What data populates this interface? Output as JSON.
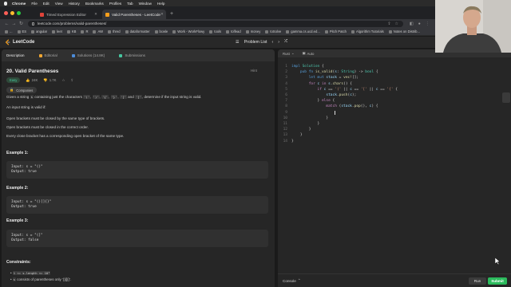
{
  "menubar": {
    "app": "Chrome",
    "items": [
      "File",
      "Edit",
      "View",
      "History",
      "Bookmarks",
      "Profiles",
      "Tab",
      "Window",
      "Help"
    ]
  },
  "tabs": [
    {
      "label": "Timed Expression Editor",
      "color": "#e0443a",
      "active": false
    },
    {
      "label": "Valid Parentheses - LeetCode",
      "color": "#f89f1b",
      "active": true
    }
  ],
  "address": {
    "url": "leetcode.com/problems/valid-parentheses/"
  },
  "bookmarks": [
    "...",
    "ES",
    "angular",
    "leet",
    "KB",
    "R",
    "AW",
    "thred",
    "dataformatter",
    "bcwle",
    "Work - WorkFlowy",
    "tools",
    "tolfead",
    "money",
    "toSolve",
    "gamma.cs.ucd.ed...",
    "Pitch Patch",
    "Algorithm Tutorials",
    "Notes on Distrib..."
  ],
  "header": {
    "brand": "LeetCode",
    "problem_list": "Problem List"
  },
  "left_tabs": [
    {
      "label": "Description",
      "active": true
    },
    {
      "label": "Editorial",
      "active": false
    },
    {
      "label": "Solutions (14.8K)",
      "active": false
    },
    {
      "label": "Submissions",
      "active": false
    }
  ],
  "problem": {
    "title": "20. Valid Parentheses",
    "hint": "Hint",
    "difficulty": "Easy",
    "likes": "24K",
    "dislikes": "1.7K",
    "companies": "Companies",
    "intro_pre": "Given a string",
    "intro_s": "s",
    "intro_mid": "containing just the characters",
    "chars": [
      "'('",
      "')'",
      "'{'",
      "'}'",
      "'['"
    ],
    "intro_and": "and",
    "last_char": "']'",
    "intro_post": ", determine if the input string is valid.",
    "valid_if": "An input string is valid if:",
    "rules": [
      "Open brackets must be closed by the same type of brackets.",
      "Open brackets must be closed in the correct order.",
      "Every close bracket has a corresponding open bracket of the same type."
    ],
    "examples": [
      {
        "label": "Example 1:",
        "input": "Input: s = \"()\"",
        "output": "Output: true"
      },
      {
        "label": "Example 2:",
        "input": "Input: s = \"()[]{}\"",
        "output": "Output: true"
      },
      {
        "label": "Example 3:",
        "input": "Input: s = \"(]\"",
        "output": "Output: false"
      }
    ],
    "constraints_label": "Constraints:",
    "constraints": [
      {
        "code": "1 <= s.length <= 10⁴",
        "text": ""
      },
      {
        "code": "s",
        "text": "consists of parentheses only '()[]{}'."
      }
    ]
  },
  "editor": {
    "language": "Rust",
    "mode": "Auto",
    "lines": [
      "impl Solution {",
      "    pub fn is_valid(s: String) -> bool {",
      "        let mut stack = vec![];",
      "        for c in s.chars() {",
      "            if c == '(' || c == '[' || c == '{' {",
      "                stack.push(c);",
      "            } else {",
      "                match (stack.pop(), c) {",
      "                    ",
      "                }",
      "            }",
      "        }",
      "    }",
      "}"
    ],
    "console": "Console",
    "run": "Run",
    "submit": "Submit"
  }
}
